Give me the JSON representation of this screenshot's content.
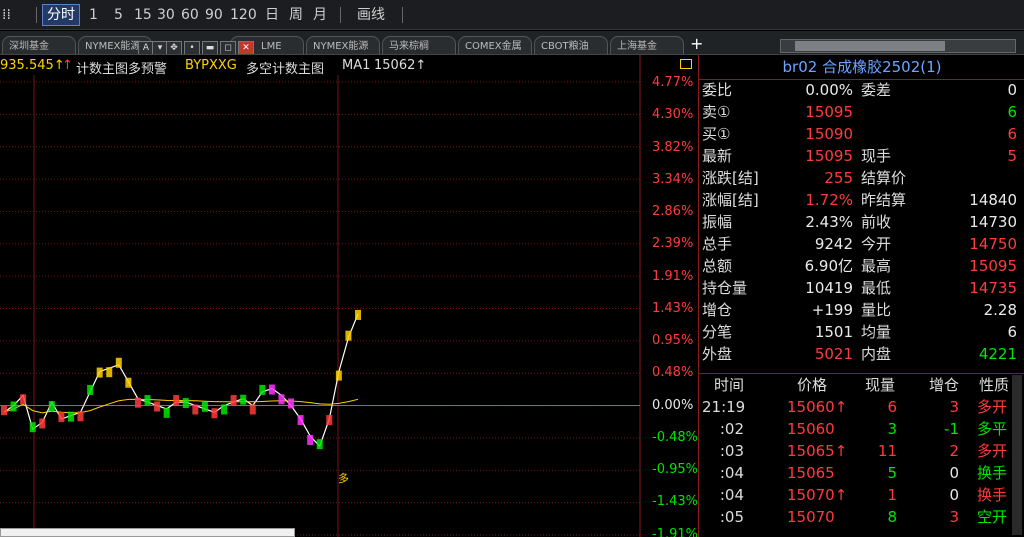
{
  "toolbar": {
    "items": [
      "分时",
      "1",
      "5",
      "15",
      "30",
      "60",
      "90",
      "120",
      "日",
      "周",
      "月"
    ],
    "draw_label": "画线"
  },
  "tabs": [
    "深圳基金",
    "NYMEX能源",
    "LME",
    "NYMEX能源",
    "马来棕榈",
    "COMEX金属",
    "CBOT粮油",
    "上海基金"
  ],
  "tab_add": "+",
  "window_controls": [
    "A",
    "▾",
    "✥",
    "•",
    "▬",
    "◻",
    "✕"
  ],
  "chart": {
    "header_prefix": "935.545↑",
    "header_flag": "↑",
    "indicator_label": "计数主图多预警",
    "indicator_code": "BYPXXG",
    "indicator_label2": "多空计数主图",
    "ma_label": "MA1",
    "ma_value": "15062↑",
    "pct_labels": [
      {
        "text": "4.77%",
        "color": "#ff3b3b"
      },
      {
        "text": "4.30%",
        "color": "#ff3b3b"
      },
      {
        "text": "3.82%",
        "color": "#ff3b3b"
      },
      {
        "text": "3.34%",
        "color": "#ff3b3b"
      },
      {
        "text": "2.86%",
        "color": "#ff3b3b"
      },
      {
        "text": "2.39%",
        "color": "#ff3b3b"
      },
      {
        "text": "1.91%",
        "color": "#ff3b3b"
      },
      {
        "text": "1.43%",
        "color": "#ff3b3b"
      },
      {
        "text": "0.95%",
        "color": "#ff3b3b"
      },
      {
        "text": "0.48%",
        "color": "#ff3b3b"
      },
      {
        "text": "0.00%",
        "color": "#eaeaea"
      },
      {
        "text": "-0.48%",
        "color": "#00e600"
      },
      {
        "text": "-0.95%",
        "color": "#00e600"
      },
      {
        "text": "-1.43%",
        "color": "#00e600"
      },
      {
        "text": "-1.91%",
        "color": "#00e600"
      }
    ],
    "end_marker": "多"
  },
  "chart_data": {
    "type": "line",
    "y_axis": "percent change",
    "ylim": [
      -1.91,
      4.77
    ],
    "series": [
      {
        "values": [
          -0.1,
          0.0,
          0.15,
          -0.35,
          -0.25,
          0.05,
          -0.2,
          -0.15,
          -0.1,
          0.2,
          0.5,
          0.55,
          0.6,
          0.35,
          0.1,
          0.05,
          0.0,
          -0.05,
          0.05,
          0.05,
          0.0,
          -0.05,
          -0.1,
          0.0,
          0.05,
          0.1,
          0.0,
          0.2,
          0.25,
          0.15,
          0.0,
          -0.2,
          -0.45,
          -0.6,
          -0.2,
          0.5,
          1.0,
          1.35
        ]
      }
    ],
    "colors": {
      "up": "#ff3b3b",
      "down": "#00e600",
      "baseline": "#ff3b3b",
      "grid": "#7a1414"
    }
  },
  "panel": {
    "title_code": "br02",
    "title_name": "合成橡胶2502",
    "title_suffix": "(1)",
    "rows": [
      {
        "l1": "委比",
        "v1": "0.00%",
        "v1c": "white",
        "l2": "委差",
        "v2": "0",
        "v2c": "white"
      },
      {
        "l1": "卖①",
        "v1": "15095",
        "v1c": "red",
        "l2": "",
        "v2": "6",
        "v2c": "green"
      },
      {
        "l1": "买①",
        "v1": "15090",
        "v1c": "red",
        "l2": "",
        "v2": "6",
        "v2c": "red"
      },
      {
        "l1": "最新",
        "v1": "15095",
        "v1c": "red",
        "l2": "现手",
        "v2": "5",
        "v2c": "red"
      },
      {
        "l1": "涨跌[结]",
        "v1": "255",
        "v1c": "red",
        "l2": "结算价",
        "v2": "",
        "v2c": "white"
      },
      {
        "l1": "涨幅[结]",
        "v1": "1.72%",
        "v1c": "red",
        "l2": "昨结算",
        "v2": "14840",
        "v2c": "white"
      },
      {
        "l1": "振幅",
        "v1": "2.43%",
        "v1c": "white",
        "l2": "前收",
        "v2": "14730",
        "v2c": "white"
      },
      {
        "l1": "总手",
        "v1": "9242",
        "v1c": "white",
        "l2": "今开",
        "v2": "14750",
        "v2c": "red"
      },
      {
        "l1": "总额",
        "v1": "6.90亿",
        "v1c": "white",
        "l2": "最高",
        "v2": "15095",
        "v2c": "red"
      },
      {
        "l1": "持仓量",
        "v1": "10419",
        "v1c": "white",
        "l2": "最低",
        "v2": "14735",
        "v2c": "red"
      },
      {
        "l1": "增仓",
        "v1": "+199",
        "v1c": "white",
        "l2": "量比",
        "v2": "2.28",
        "v2c": "white"
      },
      {
        "l1": "分笔",
        "v1": "1501",
        "v1c": "white",
        "l2": "均量",
        "v2": "6",
        "v2c": "white"
      },
      {
        "l1": "外盘",
        "v1": "5021",
        "v1c": "red",
        "l2": "内盘",
        "v2": "4221",
        "v2c": "green"
      }
    ],
    "ticks_header": [
      "时间",
      "价格",
      "现量",
      "增仓",
      "性质"
    ],
    "ticks": [
      {
        "time": "21:19",
        "price": "15060↑",
        "vol": "6",
        "vc": "red",
        "chg": "3",
        "cc": "red",
        "nat": "多开",
        "nc": "red"
      },
      {
        "time": ":02",
        "price": "15060",
        "vol": "3",
        "vc": "green",
        "chg": "-1",
        "cc": "green",
        "nat": "多平",
        "nc": "green"
      },
      {
        "time": ":03",
        "price": "15065↑",
        "vol": "11",
        "vc": "red",
        "chg": "2",
        "cc": "red",
        "nat": "多开",
        "nc": "red"
      },
      {
        "time": ":04",
        "price": "15065",
        "vol": "5",
        "vc": "green",
        "chg": "0",
        "cc": "white",
        "nat": "换手",
        "nc": "green"
      },
      {
        "time": ":04",
        "price": "15070↑",
        "vol": "1",
        "vc": "red",
        "chg": "0",
        "cc": "white",
        "nat": "换手",
        "nc": "red"
      },
      {
        "time": ":05",
        "price": "15070",
        "vol": "8",
        "vc": "green",
        "chg": "3",
        "cc": "red",
        "nat": "空开",
        "nc": "green"
      }
    ]
  }
}
